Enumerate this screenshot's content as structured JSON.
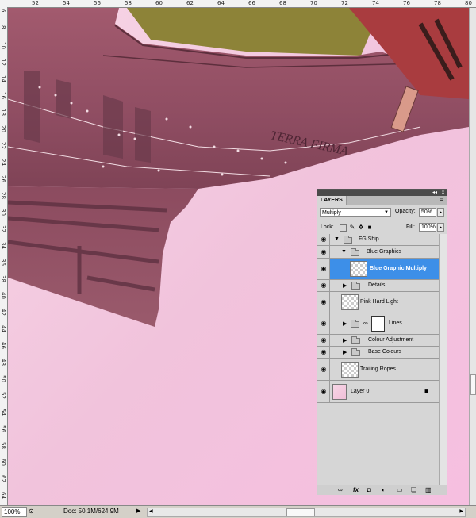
{
  "ruler_top": {
    "labels": [
      "52",
      "54",
      "56",
      "58",
      "60",
      "62",
      "64",
      "66",
      "68",
      "70",
      "72",
      "74",
      "76",
      "78",
      "80"
    ]
  },
  "ruler_left": {
    "labels": [
      "6",
      "8",
      "10",
      "12",
      "14",
      "16",
      "18",
      "20",
      "22",
      "24",
      "26",
      "28",
      "30",
      "32",
      "34",
      "36",
      "38",
      "40",
      "42",
      "44",
      "46",
      "48",
      "50",
      "52",
      "54",
      "56",
      "58",
      "60",
      "62",
      "64"
    ]
  },
  "canvas": {
    "ship_text": "TERRA FIRMA"
  },
  "status_bar": {
    "zoom": "100%",
    "doc_info": "Doc: 50.1M/624.9M",
    "arrow_label": "▶",
    "left_arrow": "◀",
    "right_arrow": "▶"
  },
  "layers_panel": {
    "tab_label": "LAYERS",
    "collapse_label": "◂◂",
    "close_label": "x",
    "menu_label": "≡",
    "blend_mode": "Multiply",
    "opacity_label": "Opacity:",
    "opacity_value": "50%",
    "lock_label": "Lock:",
    "fill_label": "Fill:",
    "fill_value": "100%",
    "layers": [
      {
        "name": "FG Ship",
        "type": "group",
        "expanded": true
      },
      {
        "name": "Blue Graphics",
        "type": "group",
        "expanded": true
      },
      {
        "name": "Blue Graphic Multiply",
        "type": "layer",
        "selected": true
      },
      {
        "name": "Details",
        "type": "group",
        "expanded": false
      },
      {
        "name": "Pink Hard Light",
        "type": "layer"
      },
      {
        "name": "Lines",
        "type": "group",
        "expanded": false,
        "masked": true
      },
      {
        "name": "Colour Adjustment",
        "type": "group",
        "expanded": false
      },
      {
        "name": "Base Colours",
        "type": "group",
        "expanded": false
      },
      {
        "name": "Trailing Ropes",
        "type": "layer"
      },
      {
        "name": "Layer 0",
        "type": "layer",
        "locked": true
      }
    ],
    "footer_icons": [
      "link-icon",
      "fx-icon",
      "mask-icon",
      "adjustment-icon",
      "folder-icon",
      "new-layer-icon",
      "trash-icon"
    ]
  },
  "colors": {
    "selection_blue": "#3d8fe8",
    "ship_hull": "#8e4a5e",
    "sky_pink": "#f4c6dc"
  }
}
